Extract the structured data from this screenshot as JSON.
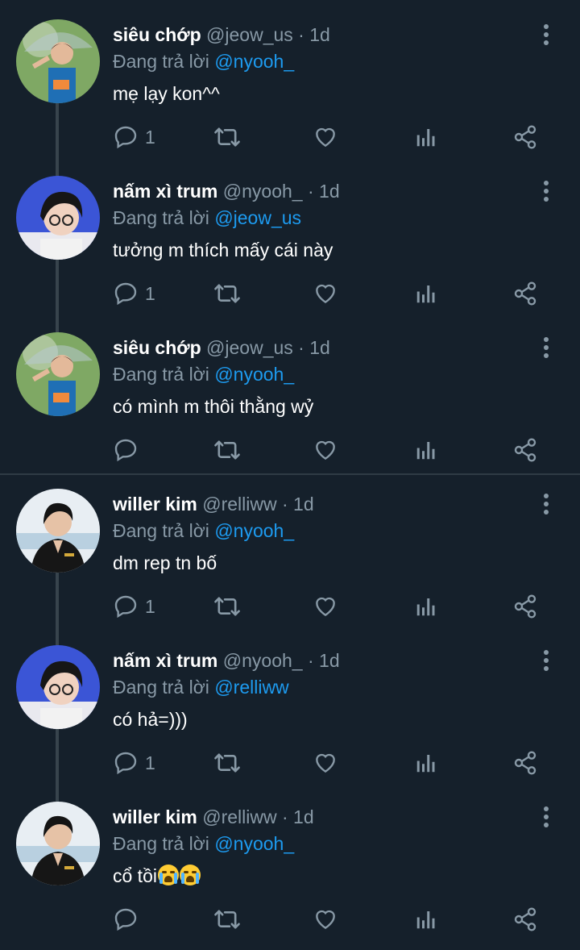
{
  "tweets": [
    {
      "name": "siêu chớp",
      "handle": "@jeow_us",
      "dot": "·",
      "time": "1d",
      "reply_prefix": "Đang trả lời",
      "mention": "@nyooh_",
      "text": "mẹ lạy kon^^",
      "reply_count": "1",
      "avatar": "umbrella-boy",
      "thread_line": true
    },
    {
      "name": "nấm xì trum",
      "handle": "@nyooh_",
      "dot": "·",
      "time": "1d",
      "reply_prefix": "Đang trả lời",
      "mention": "@jeow_us",
      "text": "tưởng m thích mấy cái này",
      "reply_count": "1",
      "avatar": "glasses-boy",
      "thread_line": true
    },
    {
      "name": "siêu chớp",
      "handle": "@jeow_us",
      "dot": "·",
      "time": "1d",
      "reply_prefix": "Đang trả lời",
      "mention": "@nyooh_",
      "text": "có mình m thôi thằng wỷ",
      "reply_count": "",
      "avatar": "umbrella-boy",
      "thread_line": false
    },
    {
      "name": "willer kim",
      "handle": "@relliww",
      "dot": "·",
      "time": "1d",
      "reply_prefix": "Đang trả lời",
      "mention": "@nyooh_",
      "text": "dm rep tn bố",
      "reply_count": "1",
      "avatar": "jacket-boy",
      "thread_line": true
    },
    {
      "name": "nấm xì trum",
      "handle": "@nyooh_",
      "dot": "·",
      "time": "1d",
      "reply_prefix": "Đang trả lời",
      "mention": "@relliww",
      "text": "có hả=)))",
      "reply_count": "1",
      "avatar": "glasses-boy",
      "thread_line": true
    },
    {
      "name": "willer kim",
      "handle": "@relliww",
      "dot": "·",
      "time": "1d",
      "reply_prefix": "Đang trả lời",
      "mention": "@nyooh_",
      "text": "cổ tồi",
      "text_emoji": "loudly-crying-face x2",
      "reply_count": "",
      "avatar": "jacket-boy",
      "thread_line": false
    }
  ],
  "colors": {
    "background": "#15202b",
    "text": "#ffffff",
    "muted": "#8899a6",
    "link": "#1d9bf0",
    "line": "#38444d"
  },
  "icons": {
    "reply": "comment-icon",
    "retweet": "retweet-icon",
    "like": "heart-icon",
    "stats": "analytics-icon",
    "share": "share-icon",
    "more": "more-vertical-icon"
  }
}
